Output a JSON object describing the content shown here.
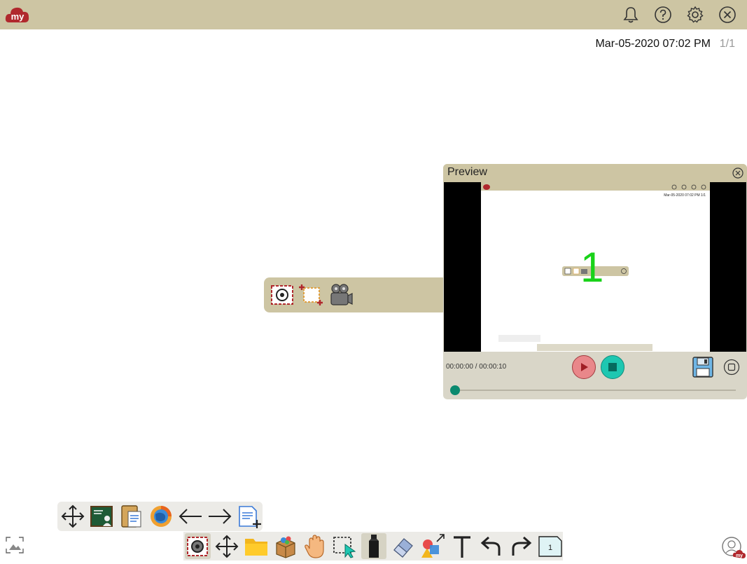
{
  "app": {
    "logo_text": "my"
  },
  "header": {
    "icons": [
      "bell-icon",
      "help-icon",
      "settings-icon",
      "close-icon"
    ],
    "datetime": "Mar-05-2020 07:02 PM",
    "page_count": "1/1"
  },
  "capture_toolbar": {
    "items": [
      "screenshot-icon",
      "region-capture-icon",
      "video-record-icon"
    ]
  },
  "preview": {
    "title": "Preview",
    "time": "00:00:00 / 00:00:10",
    "progress": 0.0,
    "screen": {
      "date": "Mar-05-2020 07:02 PM 1/1",
      "countdown": "1"
    }
  },
  "sub_toolbar": {
    "items": [
      "move-icon",
      "whiteboard-icon",
      "clipboard-icon",
      "browser-icon",
      "arrow-left-icon",
      "arrow-right-icon",
      "add-page-icon"
    ]
  },
  "main_toolbar": {
    "items": [
      "capture-icon",
      "move-icon",
      "folder-icon",
      "box-icon",
      "hand-icon",
      "select-icon",
      "marker-icon",
      "eraser-icon",
      "shape-icon",
      "text-icon",
      "undo-icon",
      "redo-icon",
      "page-icon"
    ],
    "active": "marker-icon",
    "page_label": "1"
  },
  "colors": {
    "bar": "#cdc5a3",
    "brand": "#b0282d",
    "record": "#e9878a",
    "stop": "#1ec7b1"
  }
}
